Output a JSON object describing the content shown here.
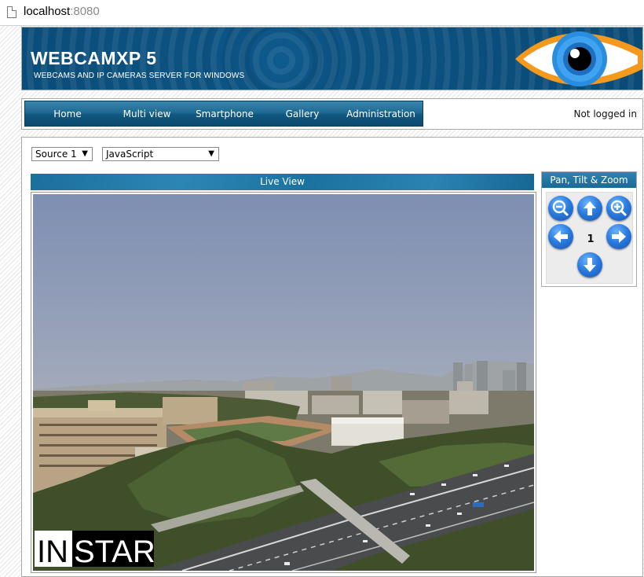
{
  "browser": {
    "url_host": "localhost",
    "url_port": ":8080",
    "page_icon": "page-icon"
  },
  "header": {
    "brand": "WEBCAMXP 5",
    "tagline": "WEBCAMS AND IP CAMERAS SERVER FOR WINDOWS",
    "logo_icon": "eye-icon"
  },
  "nav": {
    "items": [
      {
        "label": "Home"
      },
      {
        "label": "Multi view"
      },
      {
        "label": "Smartphone"
      },
      {
        "label": "Gallery"
      },
      {
        "label": "Administration"
      }
    ]
  },
  "status": {
    "login": "Not logged in"
  },
  "controls": {
    "source": "Source 1",
    "viewer": "JavaScript"
  },
  "live_view": {
    "title": "Live View",
    "watermark": "INSTAR"
  },
  "ptz": {
    "title": "Pan, Tilt & Zoom",
    "preset": "1",
    "buttons": [
      "zoom-out-icon",
      "up-arrow-icon",
      "zoom-in-icon",
      "left-arrow-icon",
      "right-arrow-icon",
      "down-arrow-icon"
    ]
  },
  "colors": {
    "brand_blue": "#0b4f7c",
    "nav_blue": "#1f6a93",
    "button_blue": "#2b7de0"
  }
}
